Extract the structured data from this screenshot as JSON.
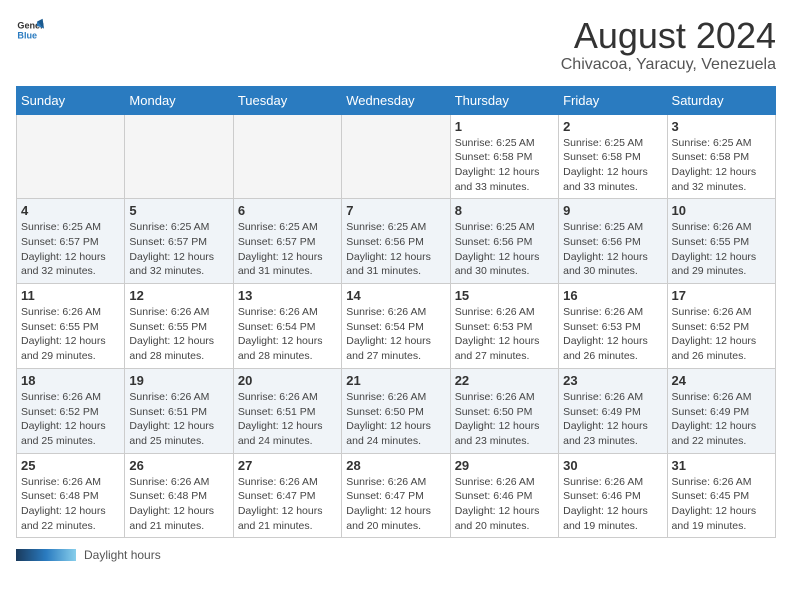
{
  "header": {
    "logo_general": "General",
    "logo_blue": "Blue",
    "title": "August 2024",
    "subtitle": "Chivacoa, Yaracuy, Venezuela"
  },
  "days_of_week": [
    "Sunday",
    "Monday",
    "Tuesday",
    "Wednesday",
    "Thursday",
    "Friday",
    "Saturday"
  ],
  "footer": {
    "label": "Daylight hours"
  },
  "weeks": [
    {
      "days": [
        {
          "num": "",
          "info": "",
          "empty": true
        },
        {
          "num": "",
          "info": "",
          "empty": true
        },
        {
          "num": "",
          "info": "",
          "empty": true
        },
        {
          "num": "",
          "info": "",
          "empty": true
        },
        {
          "num": "1",
          "info": "Sunrise: 6:25 AM\nSunset: 6:58 PM\nDaylight: 12 hours\nand 33 minutes."
        },
        {
          "num": "2",
          "info": "Sunrise: 6:25 AM\nSunset: 6:58 PM\nDaylight: 12 hours\nand 33 minutes."
        },
        {
          "num": "3",
          "info": "Sunrise: 6:25 AM\nSunset: 6:58 PM\nDaylight: 12 hours\nand 32 minutes."
        }
      ]
    },
    {
      "days": [
        {
          "num": "4",
          "info": "Sunrise: 6:25 AM\nSunset: 6:57 PM\nDaylight: 12 hours\nand 32 minutes."
        },
        {
          "num": "5",
          "info": "Sunrise: 6:25 AM\nSunset: 6:57 PM\nDaylight: 12 hours\nand 32 minutes."
        },
        {
          "num": "6",
          "info": "Sunrise: 6:25 AM\nSunset: 6:57 PM\nDaylight: 12 hours\nand 31 minutes."
        },
        {
          "num": "7",
          "info": "Sunrise: 6:25 AM\nSunset: 6:56 PM\nDaylight: 12 hours\nand 31 minutes."
        },
        {
          "num": "8",
          "info": "Sunrise: 6:25 AM\nSunset: 6:56 PM\nDaylight: 12 hours\nand 30 minutes."
        },
        {
          "num": "9",
          "info": "Sunrise: 6:25 AM\nSunset: 6:56 PM\nDaylight: 12 hours\nand 30 minutes."
        },
        {
          "num": "10",
          "info": "Sunrise: 6:26 AM\nSunset: 6:55 PM\nDaylight: 12 hours\nand 29 minutes."
        }
      ]
    },
    {
      "days": [
        {
          "num": "11",
          "info": "Sunrise: 6:26 AM\nSunset: 6:55 PM\nDaylight: 12 hours\nand 29 minutes."
        },
        {
          "num": "12",
          "info": "Sunrise: 6:26 AM\nSunset: 6:55 PM\nDaylight: 12 hours\nand 28 minutes."
        },
        {
          "num": "13",
          "info": "Sunrise: 6:26 AM\nSunset: 6:54 PM\nDaylight: 12 hours\nand 28 minutes."
        },
        {
          "num": "14",
          "info": "Sunrise: 6:26 AM\nSunset: 6:54 PM\nDaylight: 12 hours\nand 27 minutes."
        },
        {
          "num": "15",
          "info": "Sunrise: 6:26 AM\nSunset: 6:53 PM\nDaylight: 12 hours\nand 27 minutes."
        },
        {
          "num": "16",
          "info": "Sunrise: 6:26 AM\nSunset: 6:53 PM\nDaylight: 12 hours\nand 26 minutes."
        },
        {
          "num": "17",
          "info": "Sunrise: 6:26 AM\nSunset: 6:52 PM\nDaylight: 12 hours\nand 26 minutes."
        }
      ]
    },
    {
      "days": [
        {
          "num": "18",
          "info": "Sunrise: 6:26 AM\nSunset: 6:52 PM\nDaylight: 12 hours\nand 25 minutes."
        },
        {
          "num": "19",
          "info": "Sunrise: 6:26 AM\nSunset: 6:51 PM\nDaylight: 12 hours\nand 25 minutes."
        },
        {
          "num": "20",
          "info": "Sunrise: 6:26 AM\nSunset: 6:51 PM\nDaylight: 12 hours\nand 24 minutes."
        },
        {
          "num": "21",
          "info": "Sunrise: 6:26 AM\nSunset: 6:50 PM\nDaylight: 12 hours\nand 24 minutes."
        },
        {
          "num": "22",
          "info": "Sunrise: 6:26 AM\nSunset: 6:50 PM\nDaylight: 12 hours\nand 23 minutes."
        },
        {
          "num": "23",
          "info": "Sunrise: 6:26 AM\nSunset: 6:49 PM\nDaylight: 12 hours\nand 23 minutes."
        },
        {
          "num": "24",
          "info": "Sunrise: 6:26 AM\nSunset: 6:49 PM\nDaylight: 12 hours\nand 22 minutes."
        }
      ]
    },
    {
      "days": [
        {
          "num": "25",
          "info": "Sunrise: 6:26 AM\nSunset: 6:48 PM\nDaylight: 12 hours\nand 22 minutes."
        },
        {
          "num": "26",
          "info": "Sunrise: 6:26 AM\nSunset: 6:48 PM\nDaylight: 12 hours\nand 21 minutes."
        },
        {
          "num": "27",
          "info": "Sunrise: 6:26 AM\nSunset: 6:47 PM\nDaylight: 12 hours\nand 21 minutes."
        },
        {
          "num": "28",
          "info": "Sunrise: 6:26 AM\nSunset: 6:47 PM\nDaylight: 12 hours\nand 20 minutes."
        },
        {
          "num": "29",
          "info": "Sunrise: 6:26 AM\nSunset: 6:46 PM\nDaylight: 12 hours\nand 20 minutes."
        },
        {
          "num": "30",
          "info": "Sunrise: 6:26 AM\nSunset: 6:46 PM\nDaylight: 12 hours\nand 19 minutes."
        },
        {
          "num": "31",
          "info": "Sunrise: 6:26 AM\nSunset: 6:45 PM\nDaylight: 12 hours\nand 19 minutes."
        }
      ]
    }
  ]
}
